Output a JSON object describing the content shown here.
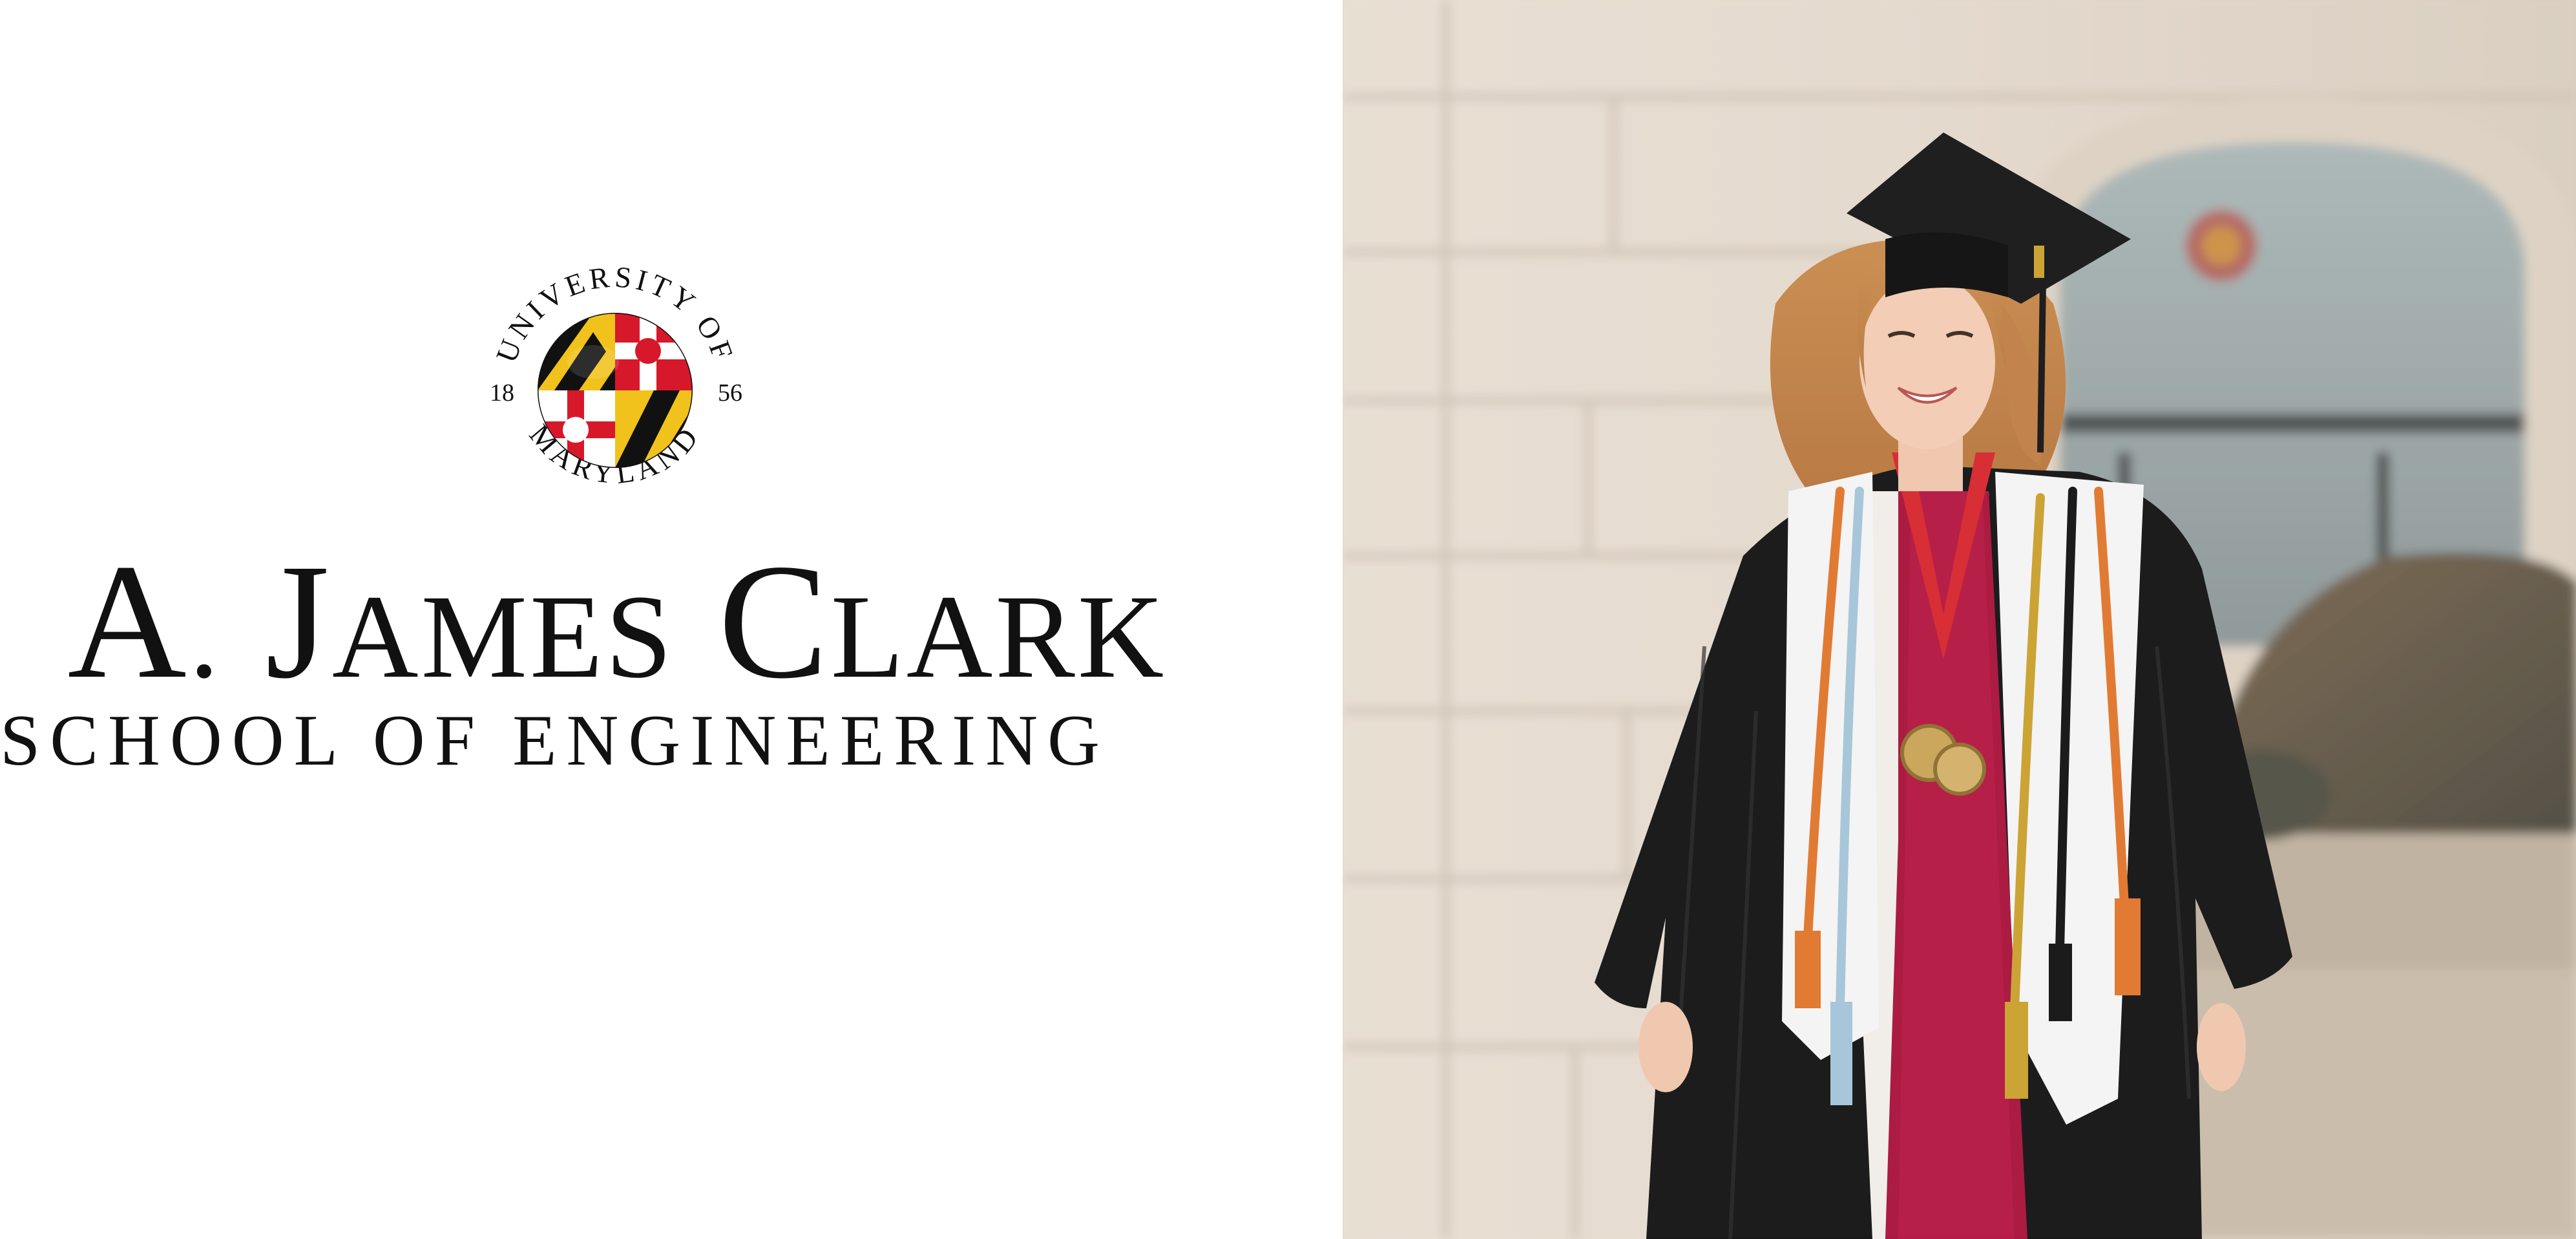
{
  "logo": {
    "seal_arc_top": "UNIVERSITY OF",
    "seal_arc_bottom": "MARYLAND",
    "seal_year_left": "18",
    "seal_year_right": "56",
    "wordmark": {
      "a_cap": "A",
      "a_rest": ".",
      "j_cap": "J",
      "j_rest": "AMES",
      "c_cap": "C",
      "c_rest": "LARK",
      "line2": "SCHOOL OF ENGINEERING"
    },
    "colors": {
      "black": "#111111",
      "gold": "#f1c21b",
      "red": "#d7182a",
      "white": "#ffffff"
    }
  },
  "photo": {
    "subject": "graduate-in-cap-and-gown",
    "colors": {
      "wall": "#e4d9cc",
      "gown": "#111111",
      "stole": "#f2f2f2",
      "sash": "#b1123a",
      "hair": "#c98a4d"
    }
  }
}
